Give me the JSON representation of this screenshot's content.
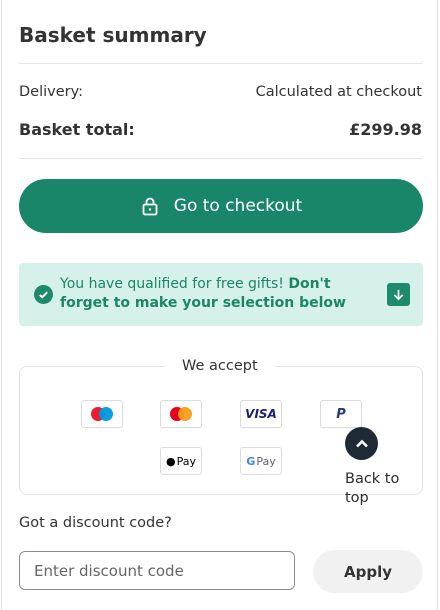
{
  "summary": {
    "title": "Basket summary",
    "delivery_label": "Delivery:",
    "delivery_value": "Calculated at checkout",
    "total_label": "Basket total:",
    "total_value": "£299.98"
  },
  "checkout": {
    "button_label": "Go to checkout",
    "icon": "lock-icon"
  },
  "gift_banner": {
    "text_regular": "You have qualified for free gifts!",
    "text_bold": "Don't forget to make your selection below",
    "icon_left": "check-circle-icon",
    "icon_right": "arrow-down-icon"
  },
  "payments": {
    "label": "We accept",
    "methods": [
      {
        "name": "maestro",
        "label": ""
      },
      {
        "name": "mastercard",
        "label": ""
      },
      {
        "name": "visa",
        "label": "VISA"
      },
      {
        "name": "paypal",
        "label": "P"
      },
      {
        "name": "apple-pay",
        "label": "Pay"
      },
      {
        "name": "google-pay",
        "label": "Pay"
      }
    ]
  },
  "back_to_top": {
    "label": "Back to top",
    "icon": "chevron-up-icon"
  },
  "discount": {
    "label": "Got a discount code?",
    "placeholder": "Enter discount code",
    "value": "",
    "apply_label": "Apply"
  },
  "colors": {
    "primary": "#198669",
    "banner_bg": "#d6f1e9",
    "back_to_top_bg": "#1f2a37"
  }
}
